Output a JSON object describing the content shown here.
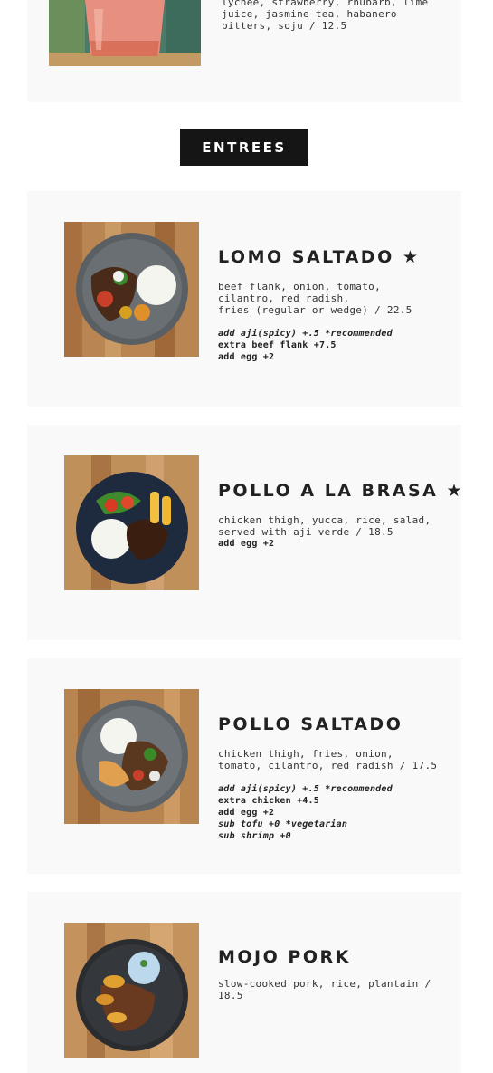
{
  "drinks": {
    "partial_item": {
      "desc_lines": [
        "lychee, strawberry, rhubarb, lime",
        "juice, jasmine tea, habanero",
        "bitters, soju / 12.5"
      ]
    }
  },
  "section": {
    "label": "ENTREES"
  },
  "entrees": [
    {
      "name": "LOMO SALTADO ★",
      "desc_lines": [
        "beef flank, onion, tomato,",
        "cilantro, red radish,",
        "fries (regular or wedge) / 22.5"
      ],
      "extras": [
        "add aji(spicy) +.5 *recommended",
        "extra beef flank +7.5",
        "add egg +2"
      ]
    },
    {
      "name": "POLLO A LA BRASA ★",
      "desc_lines": [
        "chicken thigh, yucca, rice, salad,",
        "served with aji verde / 18.5"
      ],
      "extras": [
        "add egg +2"
      ]
    },
    {
      "name": "POLLO SALTADO",
      "desc_lines": [
        "chicken thigh, fries, onion,",
        "tomato, cilantro, red radish / 17.5"
      ],
      "extras": [
        "add aji(spicy) +.5 *recommended",
        "extra chicken +4.5",
        "add egg +2",
        "sub tofu +0 *vegetarian",
        "sub shrimp +0"
      ]
    },
    {
      "name": "MOJO PORK",
      "desc_lines": [
        "slow-cooked pork, rice, plantain /",
        "18.5"
      ],
      "extras": []
    }
  ]
}
